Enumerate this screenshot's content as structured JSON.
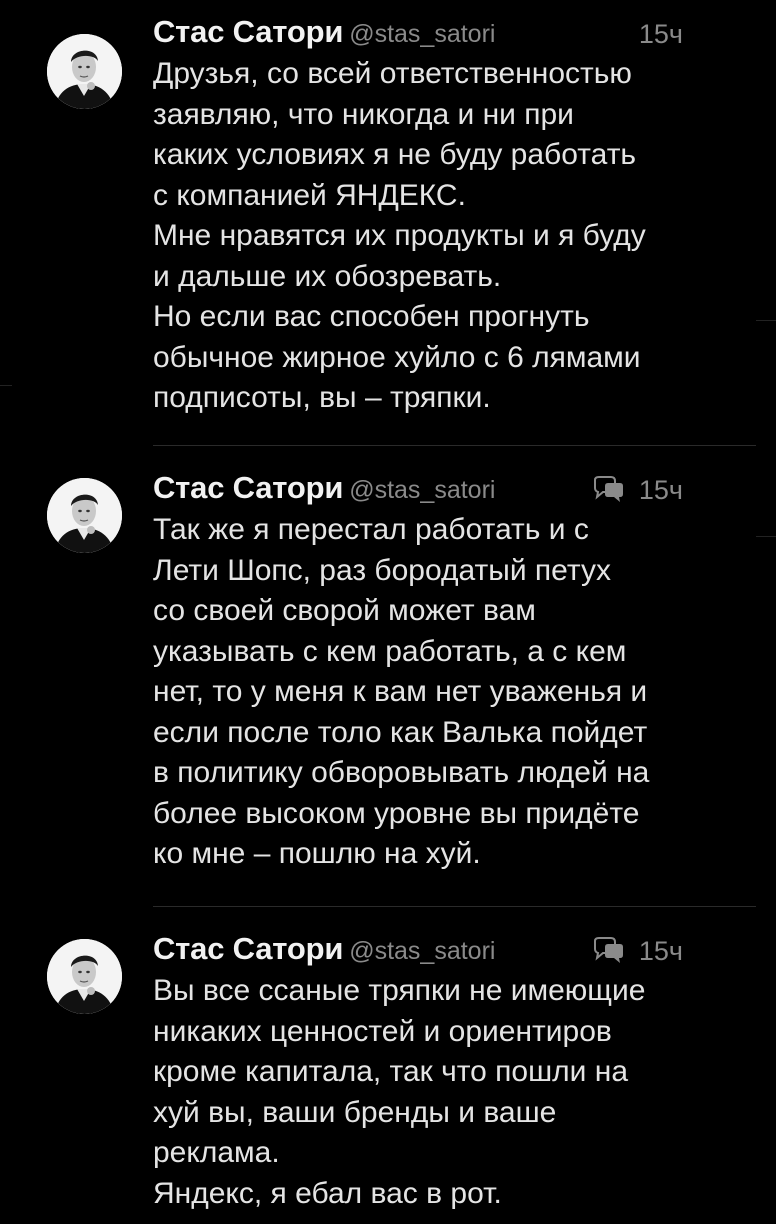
{
  "tweets": [
    {
      "author_name": "Стас Сатори",
      "author_handle": "@stas_satori",
      "time": "15ч",
      "has_reply_icon": false,
      "lines": [
        "Друзья, со всей ответственностью",
        "заявляю, что никогда и ни при",
        "каких условиях я не буду работать",
        "с компанией ЯНДЕКС.",
        "Мне нравятся их продукты и я буду",
        "и дальше их обозревать.",
        "Но если вас способен прогнуть",
        "обычное жирное хуйло с 6 лямами",
        "подписоты, вы – тряпки."
      ]
    },
    {
      "author_name": "Стас Сатори",
      "author_handle": "@stas_satori",
      "time": "15ч",
      "has_reply_icon": true,
      "lines": [
        "Так же я перестал работать и с",
        "Лети Шопс, раз бородатый петух",
        "со своей сворой может вам",
        "указывать с кем работать, а с кем",
        "нет, то у меня к вам нет уваженья и",
        "если после толо как Валька пойдет",
        "в политику обворовывать людей на",
        "более высоком уровне вы придёте",
        "ко мне – пошлю на хуй."
      ]
    },
    {
      "author_name": "Стас Сатори",
      "author_handle": "@stas_satori",
      "time": "15ч",
      "has_reply_icon": true,
      "lines": [
        "Вы все ссаные тряпки не имеющие",
        "никаких ценностей и ориентиров",
        "кроме капитала, так что пошли на",
        "хуй вы, ваши бренды и ваше",
        "реклама.",
        "Яндекс, я ебал вас в рот."
      ]
    }
  ],
  "icons": {
    "avatar": "avatar-photo",
    "reply": "reply-bubble-icon"
  },
  "colors": {
    "background": "#000000",
    "text": "#e4e4e4",
    "secondary": "#8a8a8a",
    "divider": "#2a2a2a"
  }
}
